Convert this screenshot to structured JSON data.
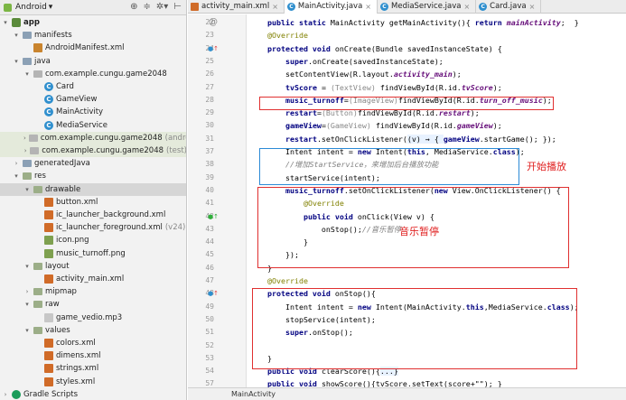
{
  "project_toolbar": {
    "view_mode": "Android",
    "icons": [
      "target-icon",
      "collapse-icon",
      "gear-icon",
      "hide-icon"
    ]
  },
  "tree": [
    {
      "id": "app",
      "label": "app",
      "depth": 0,
      "arrow": "▾",
      "icon": "module",
      "bold": true
    },
    {
      "id": "manifests",
      "label": "manifests",
      "depth": 1,
      "arrow": "▾",
      "icon": "folder"
    },
    {
      "id": "android-manifest",
      "label": "AndroidManifest.xml",
      "depth": 2,
      "arrow": "",
      "icon": "manifest"
    },
    {
      "id": "java",
      "label": "java",
      "depth": 1,
      "arrow": "▾",
      "icon": "folder"
    },
    {
      "id": "pkg-main",
      "label": "com.example.cungu.game2048",
      "depth": 2,
      "arrow": "▾",
      "icon": "pkg"
    },
    {
      "id": "card",
      "label": "Card",
      "depth": 3,
      "arrow": "",
      "icon": "class"
    },
    {
      "id": "gameview",
      "label": "GameView",
      "depth": 3,
      "arrow": "",
      "icon": "class"
    },
    {
      "id": "mainactivity",
      "label": "MainActivity",
      "depth": 3,
      "arrow": "",
      "icon": "class"
    },
    {
      "id": "mediaservice",
      "label": "MediaService",
      "depth": 3,
      "arrow": "",
      "icon": "class"
    },
    {
      "id": "pkg-androidtest",
      "label": "com.example.cungu.game2048",
      "suffix": "(androidTest)",
      "depth": 2,
      "arrow": "›",
      "icon": "pkg",
      "tint": true
    },
    {
      "id": "pkg-test",
      "label": "com.example.cungu.game2048",
      "suffix": "(test)",
      "depth": 2,
      "arrow": "›",
      "icon": "pkg",
      "tint": true
    },
    {
      "id": "generatedjava",
      "label": "generatedJava",
      "depth": 1,
      "arrow": "›",
      "icon": "folder"
    },
    {
      "id": "res",
      "label": "res",
      "depth": 1,
      "arrow": "▾",
      "icon": "folder-res"
    },
    {
      "id": "drawable",
      "label": "drawable",
      "depth": 2,
      "arrow": "▾",
      "icon": "folder-res",
      "selected": true
    },
    {
      "id": "button-xml",
      "label": "button.xml",
      "depth": 3,
      "arrow": "",
      "icon": "xml"
    },
    {
      "id": "ic-bg",
      "label": "ic_launcher_background.xml",
      "depth": 3,
      "arrow": "",
      "icon": "xml"
    },
    {
      "id": "ic-fg",
      "label": "ic_launcher_foreground.xml",
      "suffix": "(v24)",
      "depth": 3,
      "arrow": "",
      "icon": "xml"
    },
    {
      "id": "icon-png",
      "label": "icon.png",
      "depth": 3,
      "arrow": "",
      "icon": "img"
    },
    {
      "id": "music-turnoff-png",
      "label": "music_turnoff.png",
      "depth": 3,
      "arrow": "",
      "icon": "img"
    },
    {
      "id": "layout",
      "label": "layout",
      "depth": 2,
      "arrow": "▾",
      "icon": "folder-res"
    },
    {
      "id": "activity-main-xml",
      "label": "activity_main.xml",
      "depth": 3,
      "arrow": "",
      "icon": "xml"
    },
    {
      "id": "mipmap",
      "label": "mipmap",
      "depth": 2,
      "arrow": "›",
      "icon": "folder-res"
    },
    {
      "id": "raw",
      "label": "raw",
      "depth": 2,
      "arrow": "▾",
      "icon": "folder-res"
    },
    {
      "id": "game-vedio",
      "label": "game_vedio.mp3",
      "depth": 3,
      "arrow": "",
      "icon": "file"
    },
    {
      "id": "values",
      "label": "values",
      "depth": 2,
      "arrow": "▾",
      "icon": "folder-res"
    },
    {
      "id": "colors-xml",
      "label": "colors.xml",
      "depth": 3,
      "arrow": "",
      "icon": "xml"
    },
    {
      "id": "dimens-xml",
      "label": "dimens.xml",
      "depth": 3,
      "arrow": "",
      "icon": "xml"
    },
    {
      "id": "strings-xml",
      "label": "strings.xml",
      "depth": 3,
      "arrow": "",
      "icon": "xml"
    },
    {
      "id": "styles-xml",
      "label": "styles.xml",
      "depth": 3,
      "arrow": "",
      "icon": "xml"
    },
    {
      "id": "gradle-scripts",
      "label": "Gradle Scripts",
      "depth": 0,
      "arrow": "›",
      "icon": "gradle"
    }
  ],
  "tabs": [
    {
      "label": "activity_main.xml",
      "icon": "xml",
      "active": false,
      "closable": true
    },
    {
      "label": "MainActivity.java",
      "icon": "class",
      "active": true,
      "closable": true
    },
    {
      "label": "MediaService.java",
      "icon": "class",
      "active": false,
      "closable": true
    },
    {
      "label": "Card.java",
      "icon": "class",
      "active": false,
      "closable": true
    }
  ],
  "code_lines": [
    {
      "n": 22,
      "mark": "@",
      "segs": [
        [
          "",
          "    "
        ],
        [
          "kw",
          "public static "
        ],
        [
          "",
          "MainActivity getMainActivity(){ "
        ],
        [
          "kw",
          "return "
        ],
        [
          "fld",
          "mainActivity"
        ],
        [
          "",
          ";  }"
        ]
      ]
    },
    {
      "n": 23,
      "segs": [
        [
          "",
          "    "
        ],
        [
          "ann",
          "@Override"
        ]
      ]
    },
    {
      "n": 24,
      "mark": "override",
      "segs": [
        [
          "",
          "    "
        ],
        [
          "kw",
          "protected void "
        ],
        [
          "",
          "onCreate(Bundle savedInstanceState) {"
        ]
      ]
    },
    {
      "n": 25,
      "segs": [
        [
          "",
          "        "
        ],
        [
          "kw",
          "super"
        ],
        [
          "",
          ".onCreate(savedInstanceState);"
        ]
      ]
    },
    {
      "n": 26,
      "segs": [
        [
          "",
          "        setContentView(R.layout."
        ],
        [
          "fld",
          "activity_main"
        ],
        [
          "",
          ");"
        ]
      ]
    },
    {
      "n": 27,
      "segs": [
        [
          "",
          "        "
        ],
        [
          "kw",
          "tvScore "
        ],
        [
          "",
          "= "
        ],
        [
          "ca",
          "(TextView) "
        ],
        [
          "",
          "findViewById(R.id."
        ],
        [
          "fld",
          "tvScore"
        ],
        [
          "",
          ");"
        ]
      ]
    },
    {
      "n": 28,
      "segs": [
        [
          "",
          "        "
        ],
        [
          "kw",
          "music_turnoff"
        ],
        [
          "",
          "="
        ],
        [
          "ca",
          "(ImageView)"
        ],
        [
          "",
          "findViewById(R.id."
        ],
        [
          "fld",
          "turn_off_music"
        ],
        [
          "",
          ");"
        ]
      ]
    },
    {
      "n": 29,
      "segs": [
        [
          "",
          "        "
        ],
        [
          "kw",
          "restart"
        ],
        [
          "",
          "="
        ],
        [
          "ca",
          "(Button)"
        ],
        [
          "",
          "findViewById(R.id."
        ],
        [
          "fld",
          "restart"
        ],
        [
          "",
          ");"
        ]
      ]
    },
    {
      "n": 30,
      "segs": [
        [
          "",
          "        "
        ],
        [
          "kw",
          "gameView"
        ],
        [
          "",
          "="
        ],
        [
          "ca",
          "(GameView) "
        ],
        [
          "",
          "findViewById(R.id."
        ],
        [
          "fld",
          "gameView"
        ],
        [
          "",
          ");"
        ]
      ]
    },
    {
      "n": 31,
      "segs": [
        [
          "",
          "        "
        ],
        [
          "kw",
          "restart"
        ],
        [
          "",
          ".setOnClickListener("
        ],
        [
          "lam",
          "(v) → { "
        ],
        [
          "kw",
          "gameView"
        ],
        [
          "",
          ".startGame(); });"
        ]
      ]
    },
    {
      "n": 37,
      "segs": [
        [
          "",
          "        Intent intent = "
        ],
        [
          "kw",
          "new "
        ],
        [
          "",
          "Intent("
        ],
        [
          "kw",
          "this"
        ],
        [
          "",
          ", MediaService."
        ],
        [
          "kw",
          "class"
        ],
        [
          "",
          ");"
        ]
      ]
    },
    {
      "n": 38,
      "segs": [
        [
          "",
          "        "
        ],
        [
          "cm",
          "//增加StartService，来增加后台播放功能"
        ]
      ]
    },
    {
      "n": 39,
      "segs": [
        [
          "",
          "        startService(intent);"
        ]
      ]
    },
    {
      "n": 40,
      "segs": [
        [
          "",
          "        "
        ],
        [
          "kw",
          "music_turnoff"
        ],
        [
          "",
          ".setOnClickListener("
        ],
        [
          "kw",
          "new "
        ],
        [
          "",
          "View.OnClickListener() {"
        ]
      ]
    },
    {
      "n": 41,
      "segs": [
        [
          "",
          "            "
        ],
        [
          "ann",
          "@Override"
        ]
      ]
    },
    {
      "n": 42,
      "mark": "implement",
      "segs": [
        [
          "",
          "            "
        ],
        [
          "kw",
          "public void "
        ],
        [
          "",
          "onClick(View v) {"
        ]
      ]
    },
    {
      "n": 43,
      "segs": [
        [
          "",
          "                onStop();"
        ],
        [
          "cm",
          "//音乐暂停"
        ]
      ]
    },
    {
      "n": 44,
      "segs": [
        [
          "",
          "            }"
        ]
      ]
    },
    {
      "n": 45,
      "segs": [
        [
          "",
          "        });"
        ]
      ]
    },
    {
      "n": 46,
      "segs": [
        [
          "",
          "    }"
        ]
      ]
    },
    {
      "n": 47,
      "segs": [
        [
          "",
          "    "
        ],
        [
          "ann",
          "@Override"
        ]
      ]
    },
    {
      "n": 48,
      "mark": "override",
      "segs": [
        [
          "",
          "    "
        ],
        [
          "kw",
          "protected void "
        ],
        [
          "",
          "onStop(){"
        ]
      ]
    },
    {
      "n": 49,
      "segs": [
        [
          "",
          "        Intent intent = "
        ],
        [
          "kw",
          "new "
        ],
        [
          "",
          "Intent(MainActivity."
        ],
        [
          "kw",
          "this"
        ],
        [
          "",
          ",MediaService."
        ],
        [
          "kw",
          "class"
        ],
        [
          "",
          ");"
        ]
      ]
    },
    {
      "n": 50,
      "segs": [
        [
          "",
          "        stopService(intent);"
        ]
      ]
    },
    {
      "n": 51,
      "segs": [
        [
          "",
          "        "
        ],
        [
          "kw",
          "super"
        ],
        [
          "",
          ".onStop();"
        ]
      ]
    },
    {
      "n": 52,
      "segs": [
        [
          "",
          ""
        ]
      ]
    },
    {
      "n": 53,
      "segs": [
        [
          "",
          "    }"
        ]
      ]
    },
    {
      "n": 54,
      "segs": [
        [
          "",
          "    "
        ],
        [
          "kw",
          "public void "
        ],
        [
          "",
          "clearScore(){"
        ],
        [
          "lam",
          "...}"
        ]
      ]
    },
    {
      "n": 57,
      "segs": [
        [
          "",
          "    "
        ],
        [
          "kw",
          "public void "
        ],
        [
          "",
          "showScore(){"
        ],
        [
          "",
          "tvScore.setText("
        ],
        [
          "",
          "score"
        ],
        [
          "",
          "+\"\"); }"
        ]
      ]
    }
  ],
  "annotations": {
    "start_play": "开始播放",
    "music_pause": "音乐暂停"
  },
  "status": {
    "breadcrumb": "MainActivity"
  },
  "colors": {
    "red_box": "#e03030",
    "blue_box": "#2b8ad6",
    "keyword": "#000080",
    "field": "#660e7a",
    "annotation": "#808000"
  }
}
